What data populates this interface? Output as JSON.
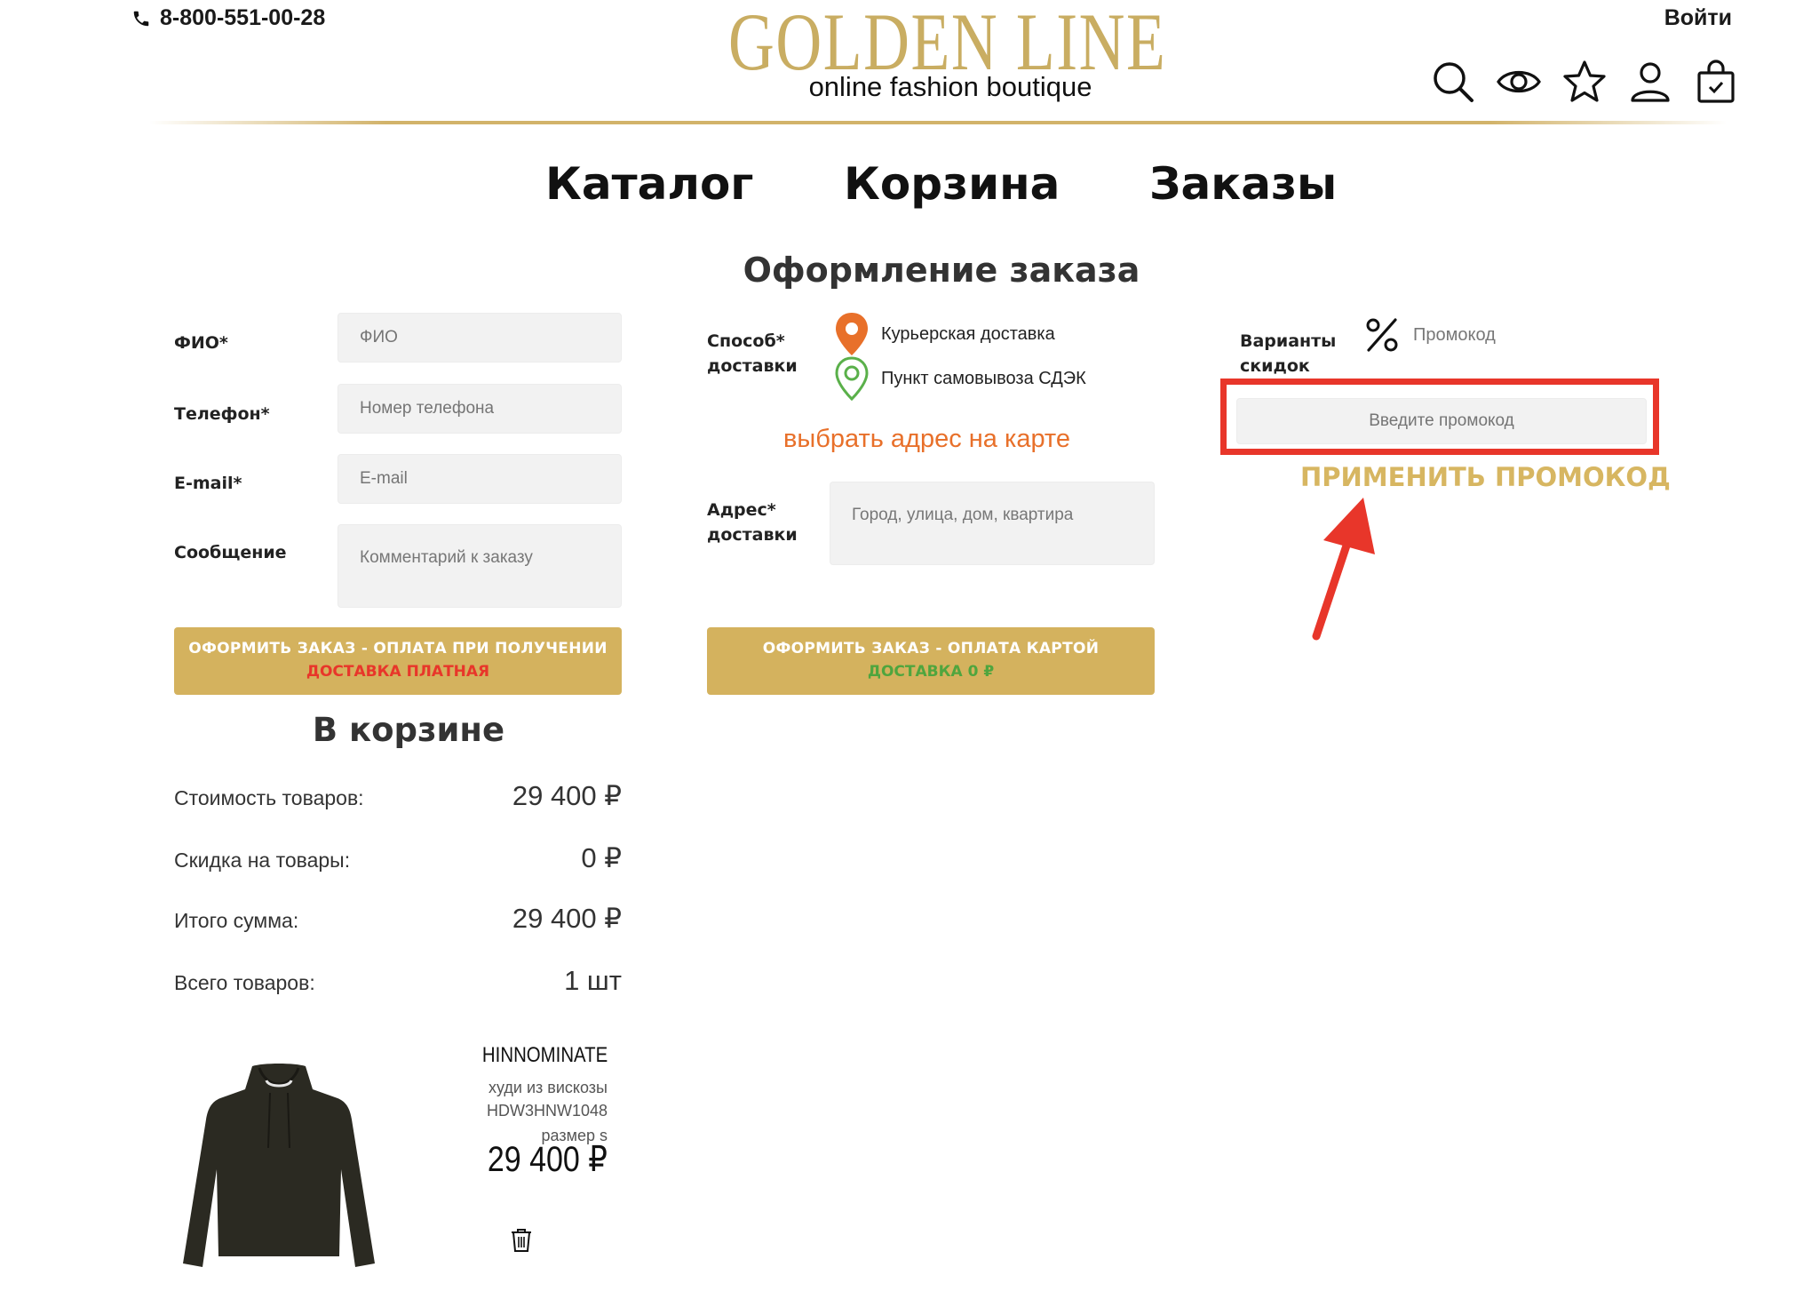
{
  "header": {
    "phone": "8-800-551-00-28",
    "logo_title": "GOLDEN LINE",
    "logo_subtitle": "online fashion boutique",
    "login": "Войти",
    "icons": [
      "search-icon",
      "eye-icon",
      "star-icon",
      "user-icon",
      "shopping-bag-icon"
    ]
  },
  "nav": {
    "catalog": "Каталог",
    "cart": "Корзина",
    "orders": "Заказы"
  },
  "page_title": "Оформление заказа",
  "form": {
    "name_label": "ФИО*",
    "name_placeholder": "ФИО",
    "phone_label": "Телефон*",
    "phone_placeholder": "Номер телефона",
    "email_label": "E-mail*",
    "email_placeholder": "E-mail",
    "message_label": "Сообщение",
    "message_placeholder": "Комментарий к заказу"
  },
  "delivery": {
    "method_label_1": "Способ*",
    "method_label_2": "доставки",
    "option_courier": "Курьерская доставка",
    "option_pickup": "Пункт самовывоза СДЭК",
    "map_link": "выбрать адрес на карте",
    "address_label_1": "Адрес*",
    "address_label_2": "доставки",
    "address_placeholder": "Город, улица, дом, квартира"
  },
  "discounts": {
    "label_1": "Варианты",
    "label_2": "скидок",
    "promo_option": "Промокод",
    "promo_placeholder": "Введите промокод",
    "apply": "ПРИМЕНИТЬ ПРОМОКОД"
  },
  "buttons": {
    "cod_line1": "ОФОРМИТЬ ЗАКАЗ - ОПЛАТА ПРИ ПОЛУЧЕНИИ",
    "cod_line2": "ДОСТАВКА ПЛАТНАЯ",
    "card_line1": "ОФОРМИТЬ ЗАКАЗ - ОПЛАТА КАРТОЙ",
    "card_line2": "ДОСТАВКА 0 ₽"
  },
  "cart": {
    "title": "В корзине",
    "rows": [
      {
        "label": "Стоимость товаров:",
        "value": "29 400 ₽"
      },
      {
        "label": "Скидка на товары:",
        "value": "0 ₽"
      },
      {
        "label": "Итого сумма:",
        "value": "29 400 ₽"
      },
      {
        "label": "Всего товаров:",
        "value": "1 шт"
      }
    ],
    "product": {
      "brand": "HINNOMINATE",
      "name": "худи из вискозы",
      "sku": "HDW3HNW1048",
      "size": "размер s",
      "price": "29 400 ₽"
    }
  },
  "colors": {
    "gold": "#d4b25e",
    "logo_gold": "#c9ad62",
    "orange": "#e8702a",
    "red": "#e8362a",
    "green": "#5ab04a"
  }
}
